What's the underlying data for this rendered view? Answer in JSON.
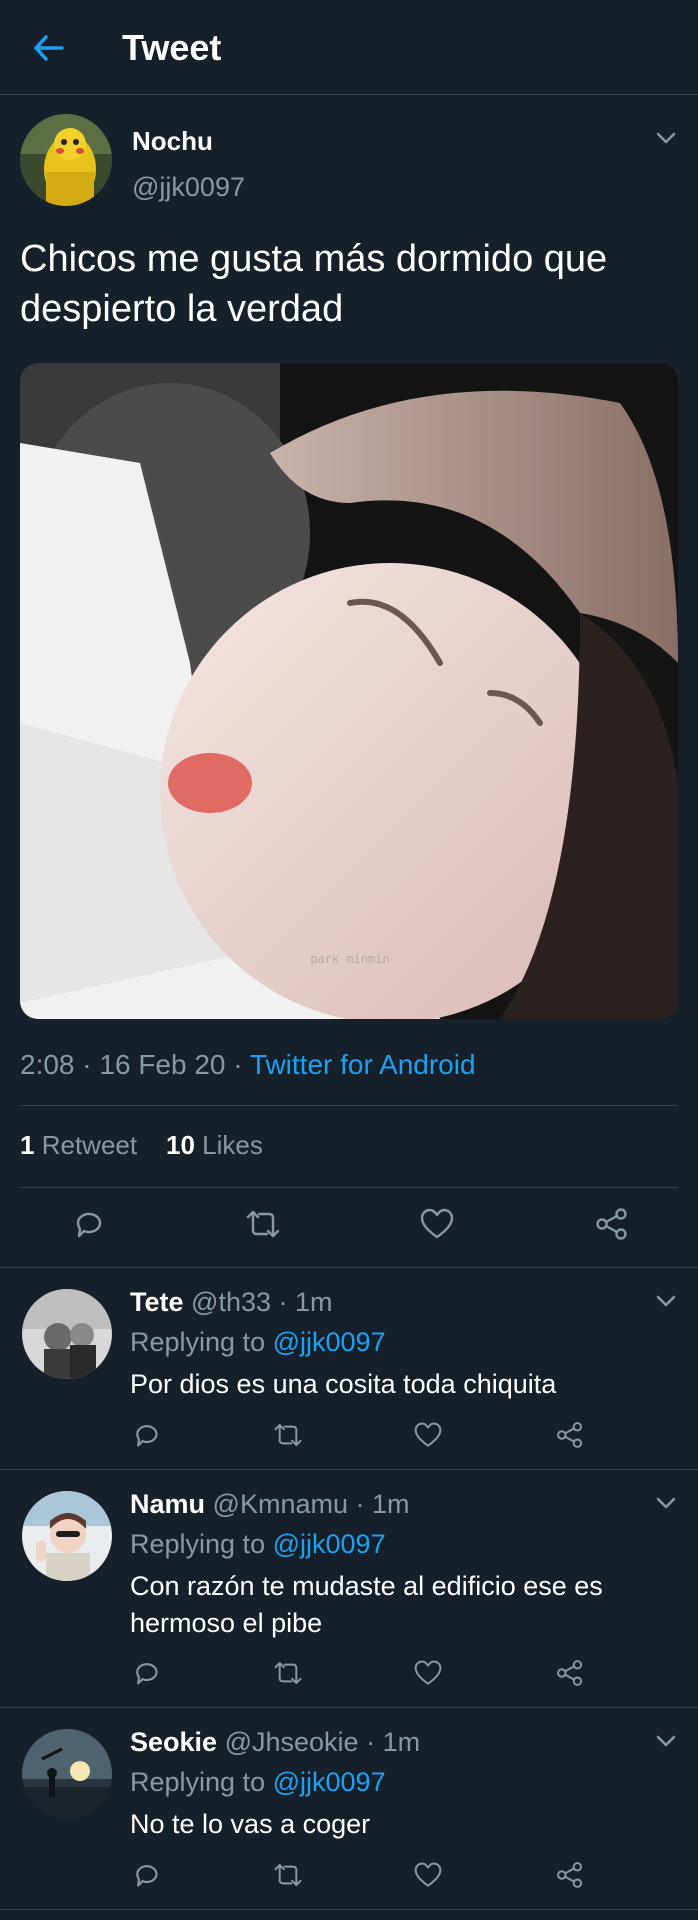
{
  "header": {
    "title": "Tweet"
  },
  "tweet": {
    "author_name": "Nochu",
    "author_handle": "@jjk0097",
    "text": "Chicos me gusta más dormido que despierto la verdad",
    "media_watermark": "park minmin",
    "time": "2:08",
    "date": "16 Feb 20",
    "source": "Twitter for Android",
    "retweet_count": "1",
    "retweet_label": "Retweet",
    "like_count": "10",
    "like_label": "Likes"
  },
  "replies": [
    {
      "name": "Tete",
      "handle": "@th33",
      "time": "1m",
      "replying_label": "Replying to",
      "replying_to": "@jjk0097",
      "text": "Por dios es una cosita toda chiquita"
    },
    {
      "name": "Namu",
      "handle": "@Kmnamu",
      "time": "1m",
      "replying_label": "Replying to",
      "replying_to": "@jjk0097",
      "text": "Con razón te mudaste al edificio ese es hermoso el pibe"
    },
    {
      "name": "Seokie",
      "handle": "@Jhseokie",
      "time": "1m",
      "replying_label": "Replying to",
      "replying_to": "@jjk0097",
      "text": "No te lo vas a coger"
    }
  ],
  "icons": [
    "back-arrow-icon",
    "chevron-down-icon",
    "reply-icon",
    "retweet-icon",
    "like-icon",
    "share-icon"
  ],
  "colors": {
    "background": "#15202b",
    "accent": "#1da1f2",
    "secondary_text": "#8899a6",
    "divider": "#38444d"
  }
}
